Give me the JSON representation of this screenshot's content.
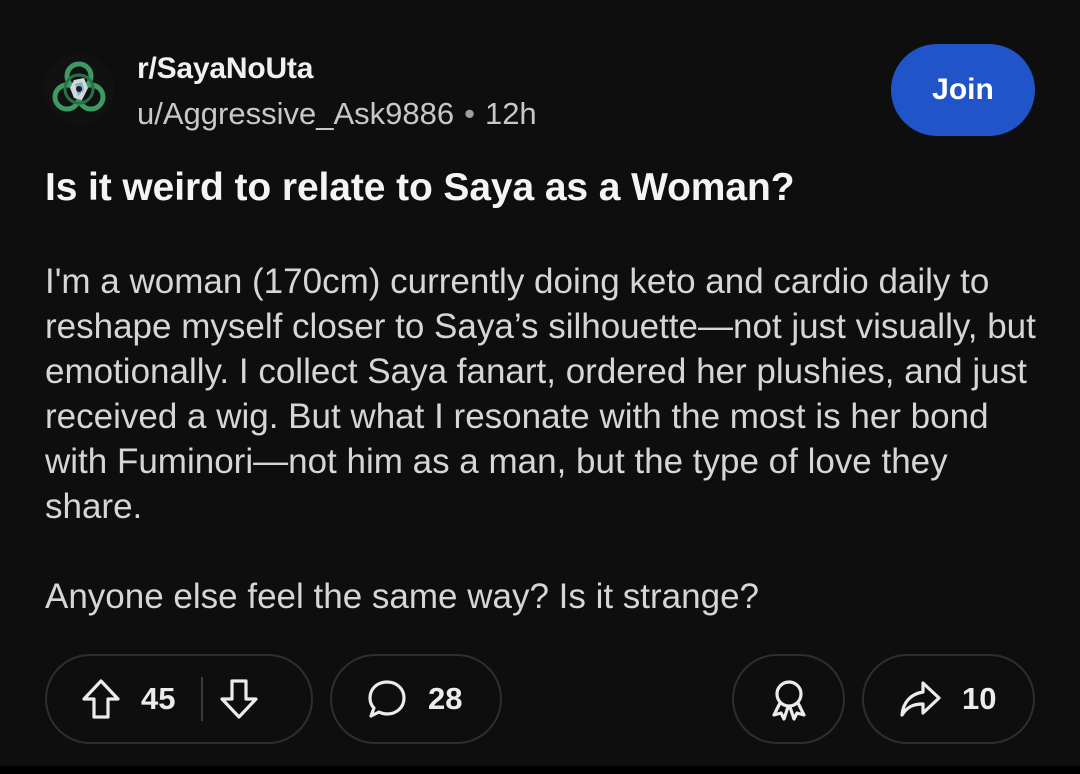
{
  "post": {
    "subreddit": "r/SayaNoUta",
    "author": "u/Aggressive_Ask9886",
    "separator": "•",
    "age": "12h",
    "join_label": "Join",
    "title": "Is it weird to relate to Saya as a Woman?",
    "paragraphs": [
      "I'm a woman (170cm) currently doing keto and cardio daily to reshape myself closer to Saya’s silhouette—not just visually, but emotionally. I collect Saya fanart, ordered her plushies, and just received a wig. But what I resonate with the most is her bond with Fuminori—not him as a man, but the type of love they share.",
      "Anyone else feel the same way? Is it strange?"
    ]
  },
  "actions": {
    "vote_count": "45",
    "comment_count": "28",
    "share_count": "10"
  },
  "icons": {
    "upvote": "upvote-arrow-icon",
    "downvote": "downvote-arrow-icon",
    "comment": "comment-bubble-icon",
    "award": "award-ribbon-icon",
    "share": "share-arrow-icon"
  },
  "colors": {
    "background": "#0e0e0e",
    "join_button": "#2154c9",
    "text_primary": "#f4f4f4",
    "text_secondary": "#c8c8c8",
    "pill_border": "#2e2e2e"
  }
}
